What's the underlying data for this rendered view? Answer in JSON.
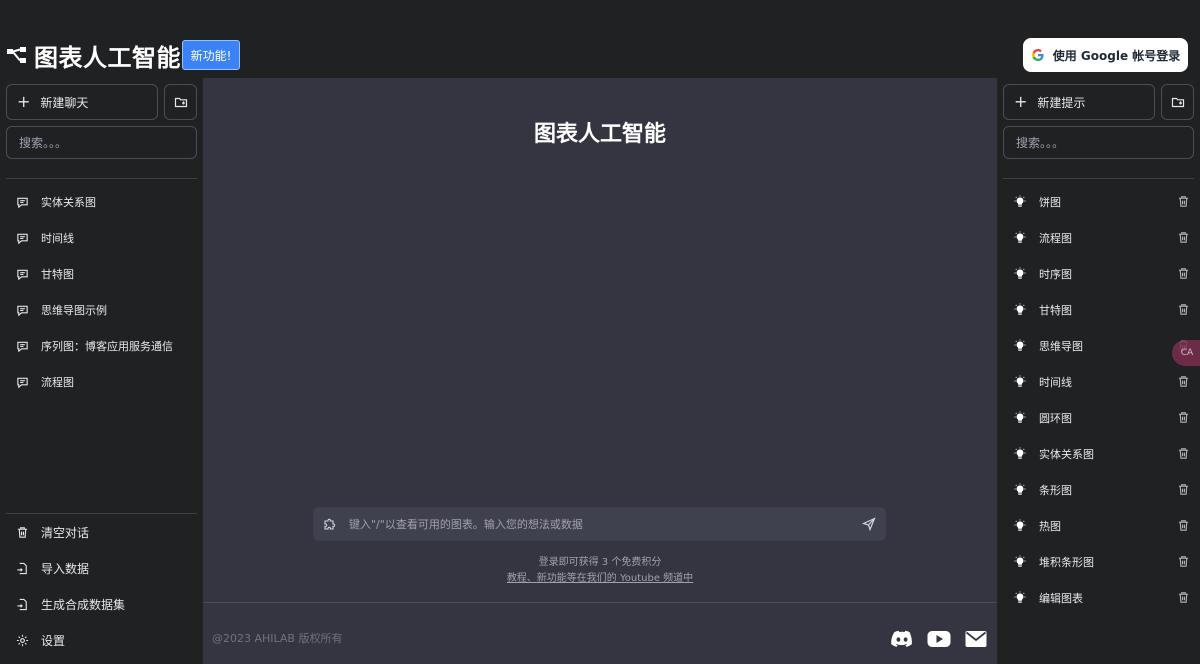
{
  "header": {
    "app_title": "图表人工智能",
    "new_feature_label": "新功能!",
    "login_label": "使用 Google 帐号登录"
  },
  "left_sidebar": {
    "new_chat_label": "新建聊天",
    "search_placeholder": "搜索。。。",
    "conversations": [
      {
        "label": "实体关系图"
      },
      {
        "label": "时间线"
      },
      {
        "label": "甘特图"
      },
      {
        "label": "思维导图示例"
      },
      {
        "label": "序列图：博客应用服务通信"
      },
      {
        "label": "流程图"
      }
    ],
    "bottom_items": [
      {
        "label": "清空对话",
        "icon": "trash-icon"
      },
      {
        "label": "导入数据",
        "icon": "file-import-icon"
      },
      {
        "label": "生成合成数据集",
        "icon": "file-import-icon"
      },
      {
        "label": "设置",
        "icon": "gear-icon"
      }
    ]
  },
  "main": {
    "title": "图表人工智能",
    "input_placeholder": "键入\"/\"以查看可用的图表。输入您的想法或数据",
    "credits_note": "登录即可获得 3 个免费积分",
    "tutorial_link": "教程、新功能等在我们的 Youtube 频道中"
  },
  "footer": {
    "copyright": "@2023 AHILAB 版权所有"
  },
  "right_sidebar": {
    "new_prompt_label": "新建提示",
    "search_placeholder": "搜索。。。",
    "prompts": [
      {
        "label": "饼图"
      },
      {
        "label": "流程图"
      },
      {
        "label": "时序图"
      },
      {
        "label": "甘特图"
      },
      {
        "label": "思维导图"
      },
      {
        "label": "时间线"
      },
      {
        "label": "圆环图"
      },
      {
        "label": "实体关系图"
      },
      {
        "label": "条形图"
      },
      {
        "label": "热图"
      },
      {
        "label": "堆积条形图"
      },
      {
        "label": "编辑图表"
      }
    ]
  },
  "floating_bubble": {
    "label": "CA"
  },
  "colors": {
    "sidebar_bg": "#202123",
    "main_bg": "#343541",
    "input_bg": "#40414f",
    "accent_blue": "#3b82f6"
  }
}
